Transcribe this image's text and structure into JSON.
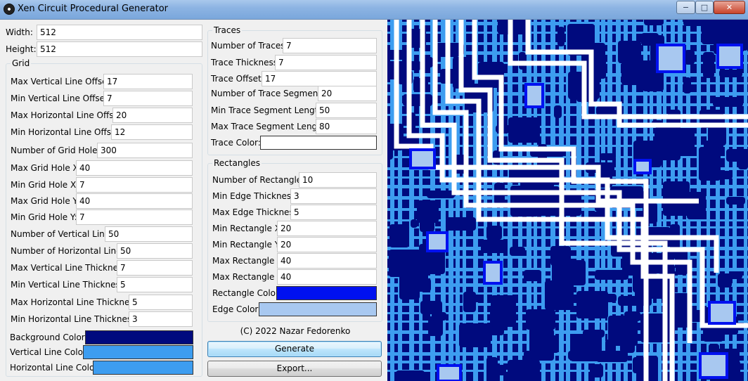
{
  "window": {
    "title": "Xen Circuit Procedural Generator",
    "min_label": "−",
    "max_label": "□",
    "close_label": "✕"
  },
  "size": {
    "width_label": "Width:",
    "width_value": "512",
    "height_label": "Height:",
    "height_value": "512"
  },
  "grid": {
    "legend": "Grid",
    "fields": [
      {
        "label": "Max Vertical Line Offset:",
        "value": "17"
      },
      {
        "label": "Min Vertical Line Offset:",
        "value": "7"
      },
      {
        "label": "Max Horizontal Line Offset:",
        "value": "20"
      },
      {
        "label": "Min Horizontal Line Offset:",
        "value": "12"
      },
      {
        "label": "Number of Grid Holes:",
        "value": "300"
      },
      {
        "label": "Max Grid Hole X:",
        "value": "40"
      },
      {
        "label": "Min Grid Hole X:",
        "value": "7"
      },
      {
        "label": "Max Grid Hole Y:",
        "value": "40"
      },
      {
        "label": "Min Grid Hole Y:",
        "value": "7"
      },
      {
        "label": "Number of Vertical Lines:",
        "value": "50"
      },
      {
        "label": "Number of Horizontal Lines:",
        "value": "50"
      },
      {
        "label": "Max Vertical Line Thickness:",
        "value": "7"
      },
      {
        "label": "Min Vertical Line Thickness:",
        "value": "5"
      },
      {
        "label": "Max Horizontal Line Thickness:",
        "value": "5"
      },
      {
        "label": "Min Horizontal Line Thickness:",
        "value": "3"
      }
    ],
    "colors": [
      {
        "label": "Background Color:",
        "color": "#000a7e"
      },
      {
        "label": "Vertical Line Color:",
        "color": "#3d9df0"
      },
      {
        "label": "Horizontal Line Color:",
        "color": "#3d9df0"
      }
    ]
  },
  "traces": {
    "legend": "Traces",
    "fields": [
      {
        "label": "Number of Traces:",
        "value": "7"
      },
      {
        "label": "Trace Thickness:",
        "value": "7"
      },
      {
        "label": "Trace Offset:",
        "value": "17"
      },
      {
        "label": "Number of Trace Segments:",
        "value": "20"
      },
      {
        "label": "Min Trace Segment Length:",
        "value": "50"
      },
      {
        "label": "Max Trace Segment Length:",
        "value": "80"
      }
    ],
    "color_label": "Trace Color:",
    "color": "#ffffff"
  },
  "rectangles": {
    "legend": "Rectangles",
    "fields": [
      {
        "label": "Number of Rectangles:",
        "value": "10"
      },
      {
        "label": "Min Edge Thickness:",
        "value": "3"
      },
      {
        "label": "Max Edge Thickness:",
        "value": "5"
      },
      {
        "label": "Min Rectangle X:",
        "value": "20"
      },
      {
        "label": "Min Rectangle Y:",
        "value": "20"
      },
      {
        "label": "Max Rectangle X:",
        "value": "40"
      },
      {
        "label": "Max Rectangle Y:",
        "value": "40"
      }
    ],
    "rect_color_label": "Rectangle Color:",
    "rect_color": "#0011f0",
    "edge_color_label": "Edge Color:",
    "edge_color": "#a8c8f0"
  },
  "footer": {
    "copyright": "(C) 2022 Nazar Fedorenko",
    "generate_label": "Generate",
    "export_label": "Export..."
  },
  "preview": {
    "background": "#000a7e",
    "line_color": "#3d9df0",
    "hole_color": "#000a5e",
    "trace_color": "#ffffff",
    "rect_edge": "#0011f0",
    "rect_fill": "#a8c8f0"
  }
}
